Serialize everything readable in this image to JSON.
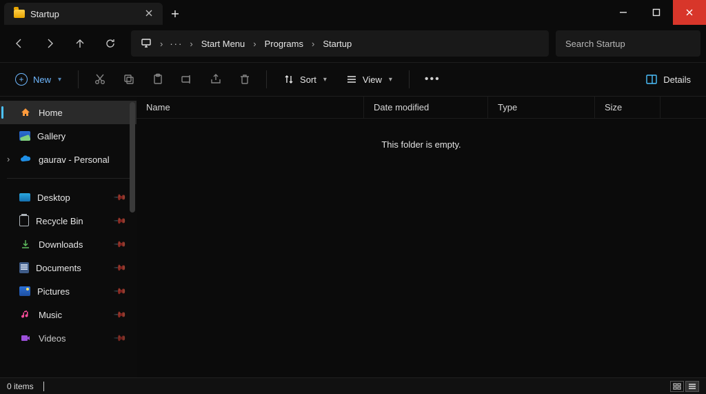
{
  "titlebar": {
    "tab_title": "Startup"
  },
  "breadcrumb": {
    "segments": [
      "Start Menu",
      "Programs",
      "Startup"
    ]
  },
  "search": {
    "placeholder": "Search Startup"
  },
  "toolbar": {
    "new_label": "New",
    "sort_label": "Sort",
    "view_label": "View",
    "details_label": "Details"
  },
  "sidebar": {
    "top": [
      {
        "label": "Home"
      },
      {
        "label": "Gallery"
      },
      {
        "label": "gaurav - Personal"
      }
    ],
    "pinned": [
      {
        "label": "Desktop"
      },
      {
        "label": "Recycle Bin"
      },
      {
        "label": "Downloads"
      },
      {
        "label": "Documents"
      },
      {
        "label": "Pictures"
      },
      {
        "label": "Music"
      },
      {
        "label": "Videos"
      }
    ]
  },
  "columns": {
    "name": "Name",
    "date": "Date modified",
    "type": "Type",
    "size": "Size"
  },
  "content": {
    "empty_message": "This folder is empty."
  },
  "statusbar": {
    "item_count": "0 items"
  }
}
